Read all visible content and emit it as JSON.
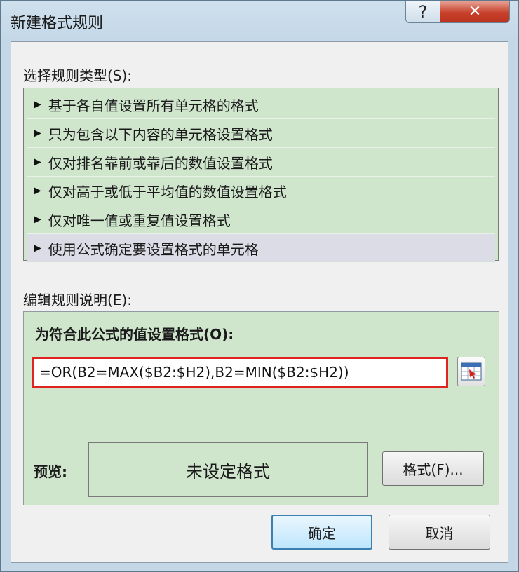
{
  "window": {
    "title": "新建格式规则",
    "help_glyph": "?",
    "close_glyph": "✕"
  },
  "rule_type": {
    "label": "选择规则类型(S):",
    "items": [
      "基于各自值设置所有单元格的格式",
      "只为包含以下内容的单元格设置格式",
      "仅对排名靠前或靠后的数值设置格式",
      "仅对高于或低于平均值的数值设置格式",
      "仅对唯一值或重复值设置格式",
      "使用公式确定要设置格式的单元格"
    ],
    "selected_index": 5,
    "bullet": "▶"
  },
  "description": {
    "label": "编辑规则说明(E):",
    "formula_label": "为符合此公式的值设置格式(O):",
    "formula_value": "=OR(B2=MAX($B2:$H2),B2=MIN($B2:$H2))",
    "preview_label": "预览:",
    "preview_text": "未设定格式",
    "format_button": "格式(F)..."
  },
  "footer": {
    "ok": "确定",
    "cancel": "取消"
  },
  "colors": {
    "list_bg": "#cfe6cd",
    "selected_bg": "#dcdce6",
    "highlight_border": "#e0231e",
    "close_red": "#c8412b"
  }
}
